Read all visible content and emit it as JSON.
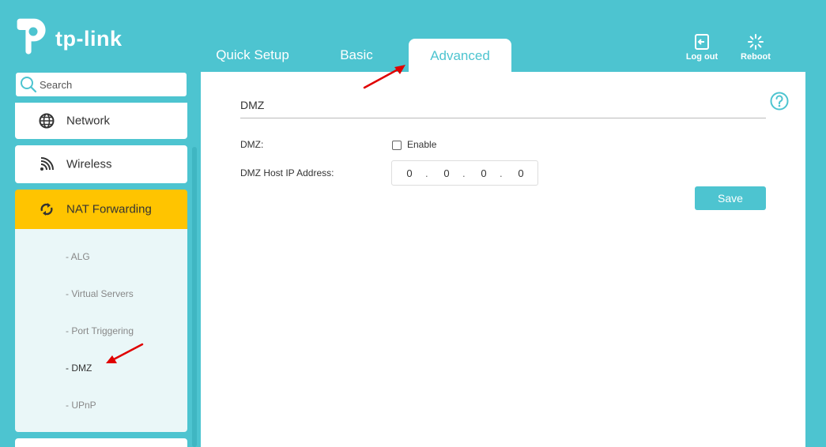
{
  "brand": {
    "name": "tp-link"
  },
  "header": {
    "tabs": [
      {
        "label": "Quick Setup"
      },
      {
        "label": "Basic"
      },
      {
        "label": "Advanced"
      }
    ],
    "logout_label": "Log out",
    "reboot_label": "Reboot"
  },
  "sidebar": {
    "search_placeholder": "Search",
    "items": [
      {
        "label": "Network",
        "icon": "globe-icon"
      },
      {
        "label": "Wireless",
        "icon": "wifi-icon"
      },
      {
        "label": "NAT Forwarding",
        "icon": "nat-forwarding-icon",
        "active": true
      }
    ],
    "subitems": [
      {
        "label": "- ALG"
      },
      {
        "label": "- Virtual Servers"
      },
      {
        "label": "- Port Triggering"
      },
      {
        "label": "- DMZ",
        "active": true
      },
      {
        "label": "- UPnP"
      }
    ]
  },
  "main": {
    "section_title": "DMZ",
    "dmz_label": "DMZ:",
    "enable_label": "Enable",
    "enable_checked": false,
    "host_ip_label": "DMZ Host IP Address:",
    "ip_octets": [
      "0",
      "0",
      "0",
      "0"
    ],
    "ip_dot": ".",
    "save_label": "Save"
  },
  "colors": {
    "accent": "#4dc4d0",
    "active_menu": "#ffc400",
    "annotation_arrow": "#e00000"
  }
}
